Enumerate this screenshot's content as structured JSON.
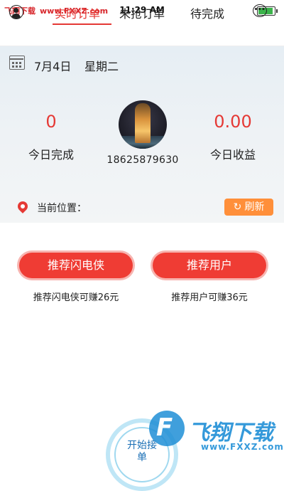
{
  "status_bar": {
    "watermark_name": "飞翔下载",
    "watermark_url": "www.FXXZ.com",
    "time": "11:29 AM",
    "battery_color": "#3bb34a"
  },
  "nav": {
    "tabs": [
      {
        "label": "实时订单",
        "active": true
      },
      {
        "label": "未抢订单",
        "active": false
      },
      {
        "label": "待完成",
        "active": false
      }
    ],
    "accent_color": "#e53935",
    "left_icon": "user-icon",
    "right_icon": "chat-icon",
    "right_icon_glyph": "•••"
  },
  "header": {
    "date": "7月4日",
    "weekday": "星期二",
    "today_completed_value": "0",
    "today_completed_label": "今日完成",
    "today_earnings_value": "0.00",
    "today_earnings_label": "今日收益",
    "phone": "18625879630",
    "location_label": "当前位置：",
    "refresh_label": "刷新",
    "refresh_icon_glyph": "↻"
  },
  "referrals": {
    "courier_button": "推荐闪电侠",
    "courier_reward": "推荐闪电侠可赚26元",
    "user_button": "推荐用户",
    "user_reward": "推荐用户可赚36元"
  },
  "start_button": {
    "label": "开始接单"
  },
  "watermark": {
    "logo_glyph": "F",
    "title": "飞翔下载",
    "url": "www.FXXZ.com"
  }
}
